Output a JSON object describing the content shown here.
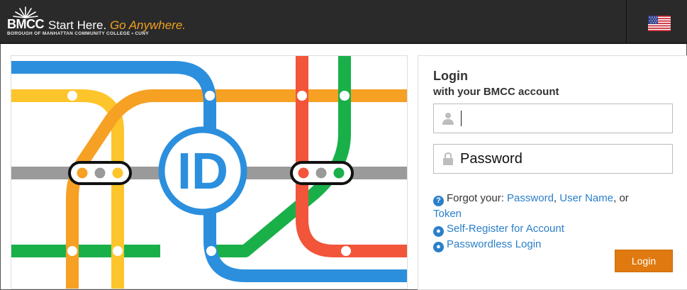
{
  "header": {
    "logo_mark": "BMCC",
    "tagline_main": "Start Here.",
    "tagline_accent": "Go Anywhere.",
    "subtitle": "BOROUGH OF MANHATTAN COMMUNITY COLLEGE • CUNY",
    "language_flag_icon": "us-flag-icon"
  },
  "illustration": {
    "center_label": "ID",
    "line_colors": {
      "blue": "#2b8fde",
      "yellow": "#fdc52b",
      "orange": "#f6a024",
      "red": "#f2553a",
      "green": "#19b04a",
      "gray": "#9a9a9a"
    }
  },
  "login": {
    "title": "Login",
    "subtitle": "with your BMCC account",
    "username_placeholder": "",
    "password_placeholder": "Password",
    "forgot_prefix": "Forgot your:",
    "forgot_password": "Password",
    "forgot_username": "User Name",
    "forgot_or": ", or",
    "forgot_token": "Token",
    "self_register": "Self-Register for Account",
    "passwordless": "Passwordless Login",
    "login_button": "Login"
  },
  "colors": {
    "topbar": "#2a2a2a",
    "link": "#2a7fc9",
    "button": "#e07a10"
  }
}
